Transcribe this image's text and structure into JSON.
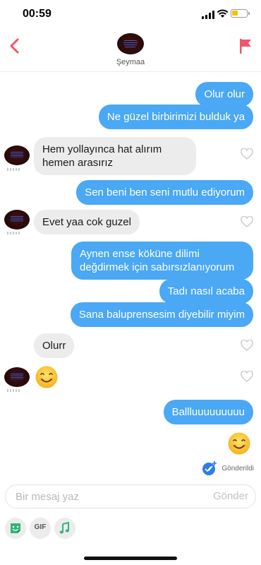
{
  "status_bar": {
    "time": "00:59"
  },
  "header": {
    "contact_name": "Şeymaa"
  },
  "messages": [
    {
      "text": "Olur olur"
    },
    {
      "text": "Ne güzel birbirimizi bulduk ya"
    },
    {
      "text": "Hem yollayınca hat alırım hemen arasırız"
    },
    {
      "text": "Sen beni ben seni mutlu ediyorum"
    },
    {
      "text": "Evet yaa cok guzel"
    },
    {
      "text": "Aynen ense köküne dilimi değdirmek için sabırsızlanıyorum"
    },
    {
      "text": "Tadı nasıl acaba"
    },
    {
      "text": "Sana baluprensesim diyebilir miyim"
    },
    {
      "text": "Olurr"
    },
    {
      "text": "Ballluuuuuuuuu"
    }
  ],
  "delivery_status": "Gönderildi",
  "composer": {
    "placeholder": "Bir mesaj yaz",
    "send_label": "Gönder"
  },
  "toolbar": {
    "gif_label": "GIF"
  },
  "colors": {
    "outgoing": "#4aa8f5",
    "incoming": "#ececec",
    "accent": "#f0576a"
  },
  "icons": [
    "back-chevron-icon",
    "flag-icon",
    "heart-icon",
    "smiling-face-emoji",
    "sent-check-icon",
    "sticker-icon",
    "gif-icon",
    "music-icon"
  ]
}
